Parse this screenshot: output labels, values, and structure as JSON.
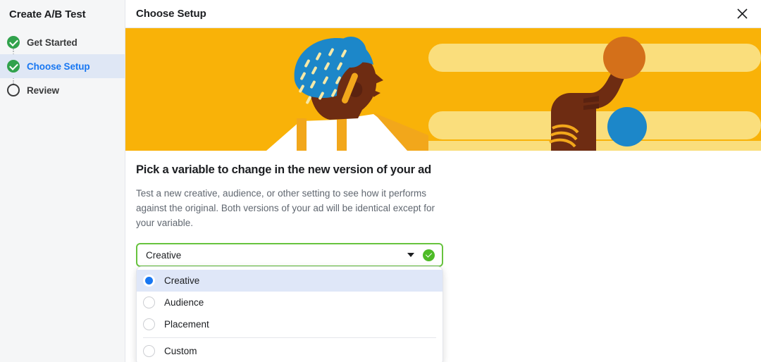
{
  "sidebar": {
    "title": "Create A/B Test",
    "steps": [
      {
        "label": "Get Started",
        "state": "done",
        "icon": "check-circle-icon"
      },
      {
        "label": "Choose Setup",
        "state": "active",
        "icon": "check-circle-icon"
      },
      {
        "label": "Review",
        "state": "todo",
        "icon": "empty-circle-icon"
      }
    ]
  },
  "topbar": {
    "title": "Choose Setup",
    "close_icon": "close-icon"
  },
  "hero": {
    "alt": "illustration-person-pointing-at-ad-options",
    "colors": {
      "background": "#F9B208",
      "bar": "#FADE7C",
      "headwrap": "#1C87C9",
      "skin": "#6E2C12",
      "skin_dark": "#4A1A0A",
      "shirt": "#FFFFFF",
      "circle_orange": "#D4701A",
      "circle_blue": "#1C87C9",
      "pencil": "#F2A71B",
      "bangle": "#F2A71B"
    }
  },
  "main": {
    "heading": "Pick a variable to change in the new version of your ad",
    "description": "Test a new creative, audience, or other setting to see how it performs against the original. Both versions of your ad will be identical except for your variable.",
    "select": {
      "value": "Creative",
      "caret_icon": "chevron-down-icon",
      "valid_icon": "check-circle-icon",
      "border_color": "#67C33E"
    },
    "dropdown": {
      "options": [
        {
          "label": "Creative",
          "selected": true
        },
        {
          "label": "Audience",
          "selected": false
        },
        {
          "label": "Placement",
          "selected": false
        },
        {
          "label": "Custom",
          "selected": false
        }
      ],
      "divider_before_index": 3
    }
  }
}
